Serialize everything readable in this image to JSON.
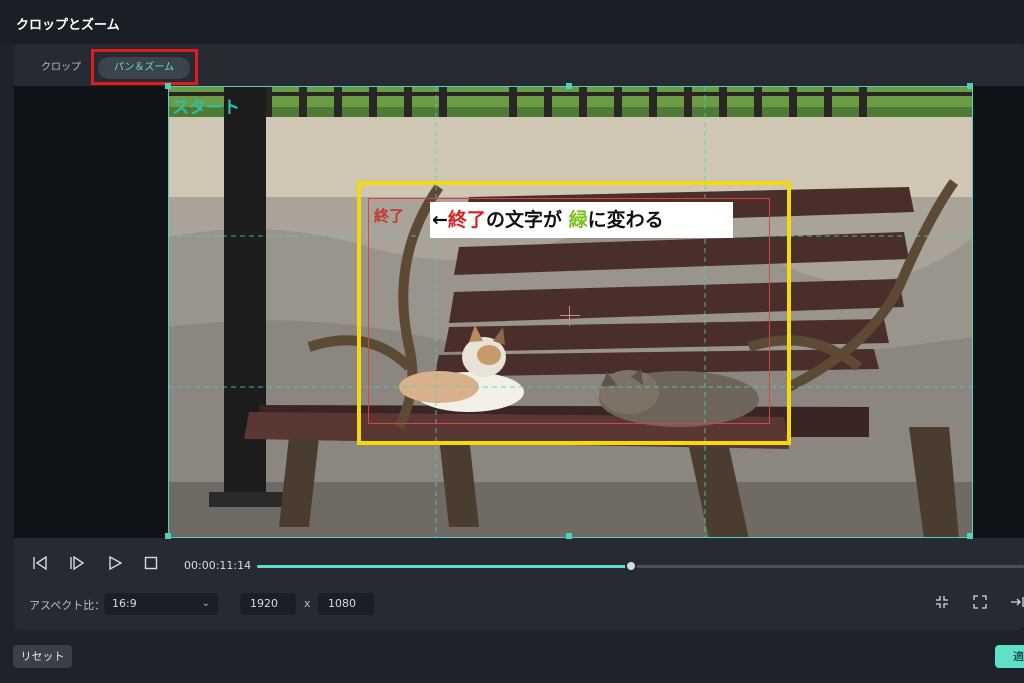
{
  "window": {
    "title": "クロップとズーム"
  },
  "tabs": [
    {
      "label": "クロップ",
      "active": false
    },
    {
      "label": "パン＆ズーム",
      "active": true
    }
  ],
  "preview": {
    "start_label": "スタート",
    "end_label": "終了",
    "annotation": {
      "arrow": "←",
      "part1": "終了",
      "part2": "の文字が",
      "part3": "緑",
      "part4": "に変わる"
    }
  },
  "playback": {
    "timecode": "00:00:11:14",
    "progress": 0.487,
    "buttons": [
      "prev-frame-icon",
      "next-frame-icon",
      "play-icon",
      "stop-icon"
    ]
  },
  "aspect": {
    "label": "アスペクト比：",
    "value": "16:9",
    "width": "1920",
    "separator": "x",
    "height": "1080"
  },
  "footer": {
    "reset_label": "リセット",
    "apply_label": "適"
  },
  "colors": {
    "accent": "#5ee0c9",
    "highlight_red": "#e21b1b",
    "annotation_yellow": "#f5d90d",
    "start_label_teal": "#28c1a8",
    "end_label_red": "#c0392b"
  }
}
